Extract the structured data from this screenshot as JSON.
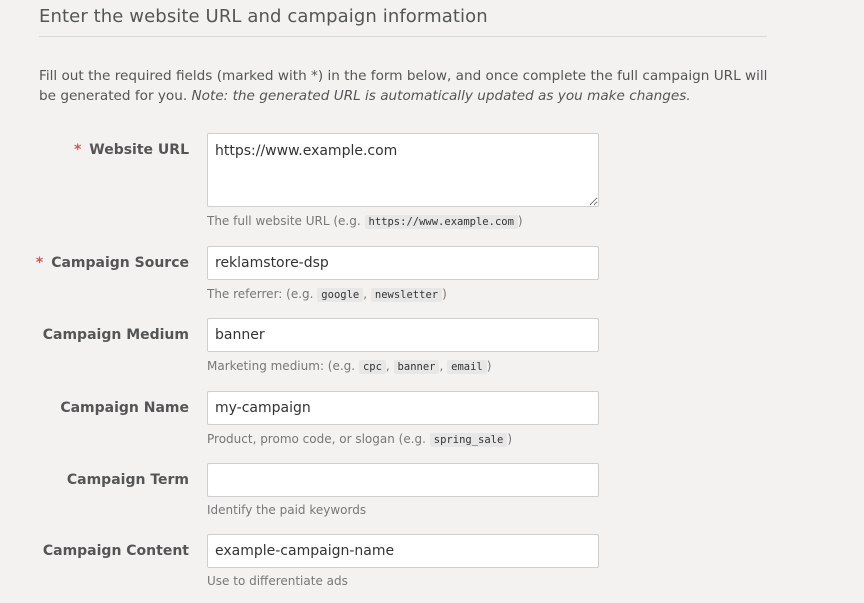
{
  "section": {
    "title": "Enter the website URL and campaign information",
    "intro": "Fill out the required fields (marked with *) in the form below, and once complete the full campaign URL will be generated for you.",
    "intro_note": "Note: the generated URL is automatically updated as you make changes."
  },
  "required_marker": "*",
  "fields": {
    "website_url": {
      "label": "Website URL",
      "value": "https://www.example.com",
      "help_prefix": "The full website URL (e.g.",
      "examples": [
        "https://www.example.com"
      ],
      "help_suffix": ")"
    },
    "campaign_source": {
      "label": "Campaign Source",
      "value": "reklamstore-dsp",
      "help_prefix": "The referrer: (e.g.",
      "examples": [
        "google",
        "newsletter"
      ],
      "help_suffix": ")"
    },
    "campaign_medium": {
      "label": "Campaign Medium",
      "value": "banner",
      "help_prefix": "Marketing medium: (e.g.",
      "examples": [
        "cpc",
        "banner",
        "email"
      ],
      "help_suffix": ")"
    },
    "campaign_name": {
      "label": "Campaign Name",
      "value": "my-campaign",
      "help_prefix": "Product, promo code, or slogan (e.g.",
      "examples": [
        "spring_sale"
      ],
      "help_suffix": ")"
    },
    "campaign_term": {
      "label": "Campaign Term",
      "value": "",
      "help": "Identify the paid keywords"
    },
    "campaign_content": {
      "label": "Campaign Content",
      "value": "example-campaign-name",
      "help": "Use to differentiate ads"
    }
  },
  "colors": {
    "background": "#f3f2f1",
    "required_marker": "#d9534f",
    "input_border": "#cfcfcf"
  }
}
